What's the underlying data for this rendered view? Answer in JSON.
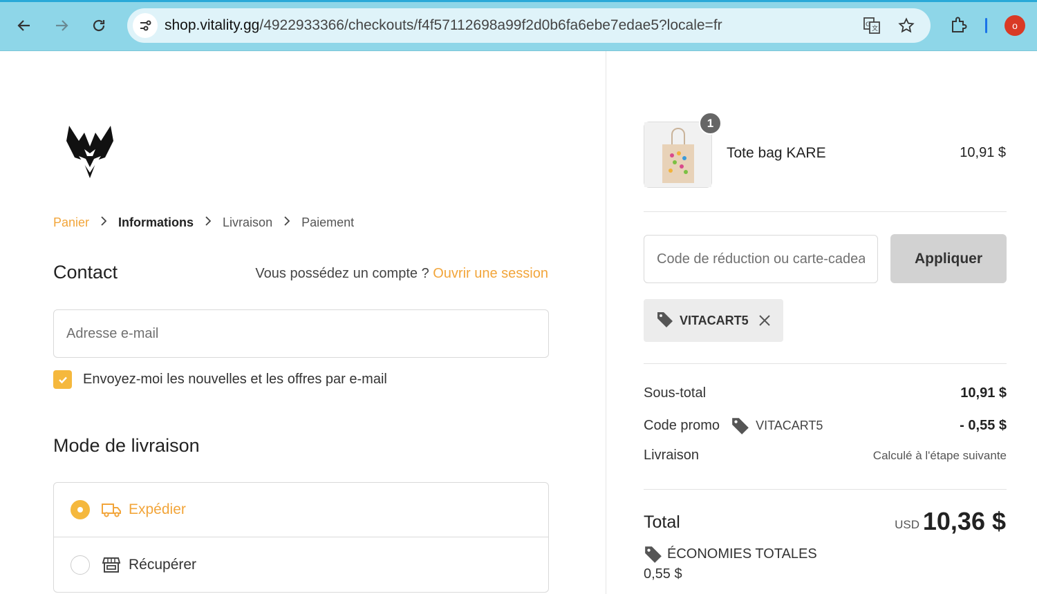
{
  "browser": {
    "url_host": "shop.vitality.gg",
    "url_rest": "/4922933366/checkouts/f4f57112698a99f2d0b6fa6ebe7edae5?locale=fr",
    "profile_initial": "o",
    "icons": [
      "back-arrow-icon",
      "forward-arrow-icon",
      "reload-icon",
      "site-info-icon",
      "translate-icon",
      "star-icon",
      "extensions-icon"
    ]
  },
  "breadcrumb": {
    "cart": "Panier",
    "info": "Informations",
    "shipping": "Livraison",
    "payment": "Paiement"
  },
  "contact": {
    "title": "Contact",
    "account_prompt": "Vous possédez un compte ? ",
    "login_link": "Ouvrir une session",
    "email_placeholder": "Adresse e-mail",
    "newsletter_label": "Envoyez-moi les nouvelles et les offres par e-mail",
    "newsletter_checked": true
  },
  "delivery": {
    "title": "Mode de livraison",
    "options": [
      {
        "label": "Expédier",
        "selected": true,
        "icon": "truck-icon"
      },
      {
        "label": "Récupérer",
        "selected": false,
        "icon": "store-icon"
      }
    ]
  },
  "summary": {
    "product": {
      "name": "Tote bag KARE",
      "price": "10,91 $",
      "quantity": "1"
    },
    "discount_placeholder": "Code de réduction ou carte-cadeau",
    "apply_label": "Appliquer",
    "applied_code": "VITACART5",
    "subtotal_label": "Sous-total",
    "subtotal_value": "10,91 $",
    "promo_label": "Code promo",
    "promo_code": "VITACART5",
    "promo_value": "- 0,55 $",
    "shipping_label": "Livraison",
    "shipping_note": "Calculé à l'étape suivante",
    "total_label": "Total",
    "currency": "USD",
    "total_value": "10,36 $",
    "savings_label": "ÉCONOMIES TOTALES",
    "savings_value": "0,55 $"
  },
  "colors": {
    "accent": "#f2a53a",
    "checkbox": "#f5b83d",
    "browser_bar": "#8ed6e8"
  }
}
